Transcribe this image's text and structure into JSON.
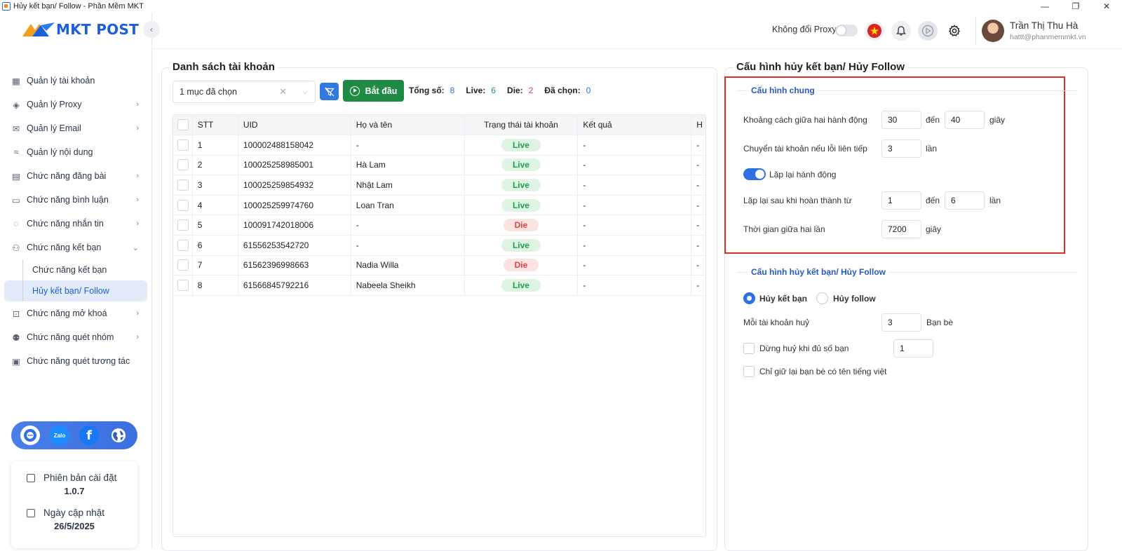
{
  "window": {
    "title": "Hủy kết bạn/ Follow - Phần Mềm MKT",
    "minimize": "—",
    "restore": "❐",
    "close": "✕"
  },
  "logo": {
    "text": "MKT POST"
  },
  "sidebar": {
    "items": [
      {
        "label": "Quản lý tài khoản",
        "icon": "dashboard-icon",
        "chevron": ""
      },
      {
        "label": "Quản lý Proxy",
        "icon": "layers-icon",
        "chevron": "›"
      },
      {
        "label": "Quản lý Email",
        "icon": "mail-icon",
        "chevron": "›"
      },
      {
        "label": "Quản lý nội dung",
        "icon": "content-icon",
        "chevron": ""
      },
      {
        "label": "Chức năng đăng bài",
        "icon": "post-icon",
        "chevron": "›"
      },
      {
        "label": "Chức năng bình luận",
        "icon": "comment-icon",
        "chevron": "›"
      },
      {
        "label": "Chức năng nhắn tin",
        "icon": "chat-icon",
        "chevron": "›"
      },
      {
        "label": "Chức năng kết bạn",
        "icon": "add-friend-icon",
        "chevron": "⌄"
      }
    ],
    "sub_items": [
      {
        "label": "Chức năng kết bạn"
      },
      {
        "label": "Hủy kết bạn/ Follow"
      }
    ],
    "items_after": [
      {
        "label": "Chức năng mở khoá",
        "icon": "lock-icon",
        "chevron": "›"
      },
      {
        "label": "Chức năng quét nhóm",
        "icon": "group-icon",
        "chevron": "›"
      },
      {
        "label": "Chức năng quét tương tác",
        "icon": "scan-icon",
        "chevron": ""
      }
    ],
    "social": {
      "zalo": "Zalo",
      "facebook": "f"
    },
    "version": {
      "label": "Phiên bản cài đặt",
      "value": "1.0.7"
    },
    "update": {
      "label": "Ngày cập nhật",
      "value": "26/5/2025"
    }
  },
  "header": {
    "proxy_label": "Không đổi Proxy",
    "user_name": "Trần Thị Thu Hà",
    "user_email": "hattt@phanmemmkt.vn"
  },
  "accounts": {
    "title": "Danh sách tài khoản",
    "select_value": "1 mục đã chọn",
    "start_label": "Bắt đầu",
    "stats": {
      "total_label": "Tổng số:",
      "total": "8",
      "live_label": "Live:",
      "live": "6",
      "die_label": "Die:",
      "die": "2",
      "selected_label": "Đã chọn:",
      "selected": "0"
    },
    "colors": {
      "total": "#2f6fe4",
      "live": "#1f9d4a",
      "die": "#e04343",
      "selected": "#2f6fe4"
    },
    "columns": [
      "STT",
      "UID",
      "Họ và tên",
      "Trạng thái tài khoản",
      "Kết quả",
      "H"
    ],
    "rows": [
      {
        "stt": "1",
        "uid": "100002488158042",
        "name": "-",
        "status": "Live",
        "result": "-",
        "extra": "-"
      },
      {
        "stt": "2",
        "uid": "100025258985001",
        "name": "Hà Lam",
        "status": "Live",
        "result": "-",
        "extra": "-"
      },
      {
        "stt": "3",
        "uid": "100025259854932",
        "name": "Nhật Lam",
        "status": "Live",
        "result": "-",
        "extra": "-"
      },
      {
        "stt": "4",
        "uid": "100025259974760",
        "name": "Loan Tran",
        "status": "Live",
        "result": "-",
        "extra": "-"
      },
      {
        "stt": "5",
        "uid": "100091742018006",
        "name": "-",
        "status": "Die",
        "result": "-",
        "extra": "-"
      },
      {
        "stt": "6",
        "uid": "61556253542720",
        "name": "-",
        "status": "Live",
        "result": "-",
        "extra": "-"
      },
      {
        "stt": "7",
        "uid": "61562396998663",
        "name": "Nadia Willa",
        "status": "Die",
        "result": "-",
        "extra": "-"
      },
      {
        "stt": "8",
        "uid": "61566845792216",
        "name": "Nabeela Sheikh",
        "status": "Live",
        "result": "-",
        "extra": "-"
      }
    ]
  },
  "config": {
    "title": "Cấu hình hủy kết bạn/ Hủy Follow",
    "general": {
      "title": "Cấu hình chung",
      "delay_label": "Khoảng cách giữa hai hành động",
      "delay_from": "30",
      "delay_to_label": "đến",
      "delay_to": "40",
      "delay_unit": "giây",
      "switch_label": "Chuyển tài khoản nếu lỗi liên tiếp",
      "switch_value": "3",
      "switch_unit": "lần",
      "repeat_label": "Lặp lại hành động",
      "repeat_on": true,
      "repeat_after_label": "Lặp lại sau khi hoàn thành từ",
      "repeat_from": "1",
      "repeat_to_label": "đến",
      "repeat_to": "6",
      "repeat_unit": "lần",
      "interval_label": "Thời gian giữa hai lần",
      "interval_value": "7200",
      "interval_unit": "giây"
    },
    "unfriend": {
      "title": "Cấu hình hủy kết bạn/ Hủy Follow",
      "radio_unfriend": "Hủy kết bạn",
      "radio_unfollow": "Hủy follow",
      "selected": "unfriend",
      "per_account_label": "Mỗi tài khoản huỷ",
      "per_account_value": "3",
      "per_account_unit": "Bạn bè",
      "stop_label": "Dừng huỷ khi đủ số bạn",
      "stop_value": "1",
      "keep_vn_label": "Chỉ giữ lại bạn bè có tên tiếng việt"
    }
  }
}
